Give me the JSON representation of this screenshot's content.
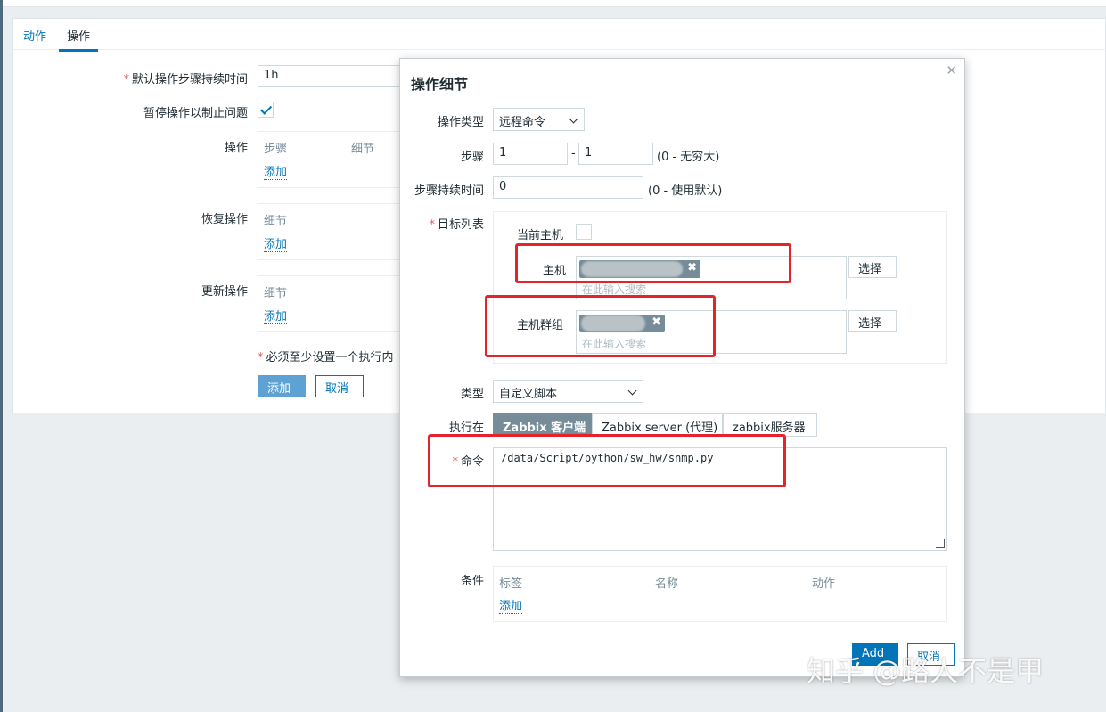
{
  "tabs": [
    "动作",
    "操作"
  ],
  "form": {
    "default_duration_label": "默认操作步骤持续时间",
    "default_duration_value": "1h",
    "pause_label": "暂停操作以制止问题",
    "pause_checked": true,
    "ops_label": "操作",
    "ops_headers": [
      "步骤",
      "细节"
    ],
    "add_link": "添加",
    "recovery_label": "恢复操作",
    "recovery_header": "细节",
    "update_label": "更新操作",
    "update_header": "细节",
    "note": "必须至少设置一个执行内",
    "add_button": "添加",
    "cancel_button": "取消"
  },
  "dialog": {
    "title": "操作细节",
    "close_icon": "close-icon",
    "op_type_label": "操作类型",
    "op_type_value": "远程命令",
    "steps_label": "步骤",
    "step_from": "1",
    "step_dash": "-",
    "step_to": "1",
    "steps_hint": "(0 - 无穷大)",
    "step_duration_label": "步骤持续时间",
    "step_duration_value": "0",
    "step_duration_hint": "(0 - 使用默认)",
    "target_list_label": "目标列表",
    "current_host_label": "当前主机",
    "host_label": "主机",
    "host_placeholder": "在此输入搜索",
    "hostgroup_label": "主机群组",
    "hostgroup_placeholder": "在此输入搜索",
    "select_button": "选择",
    "type_label": "类型",
    "type_value": "自定义脚本",
    "execute_on_label": "执行在",
    "execute_options": [
      "Zabbix 客户端",
      "Zabbix server (代理)",
      "zabbix服务器"
    ],
    "execute_selected": "Zabbix 客户端",
    "command_label": "命令",
    "command_value": "/data/Script/python/sw_hw/snmp.py",
    "conditions_label": "条件",
    "conditions_headers": [
      "标签",
      "名称",
      "动作"
    ],
    "conditions_add": "添加",
    "footer_add": "Add",
    "footer_cancel": "取消"
  },
  "watermark": "知乎 @路人不是甲",
  "colors": {
    "accent": "#0275b8",
    "highlight": "#e3242b",
    "tag": "#768d99"
  }
}
